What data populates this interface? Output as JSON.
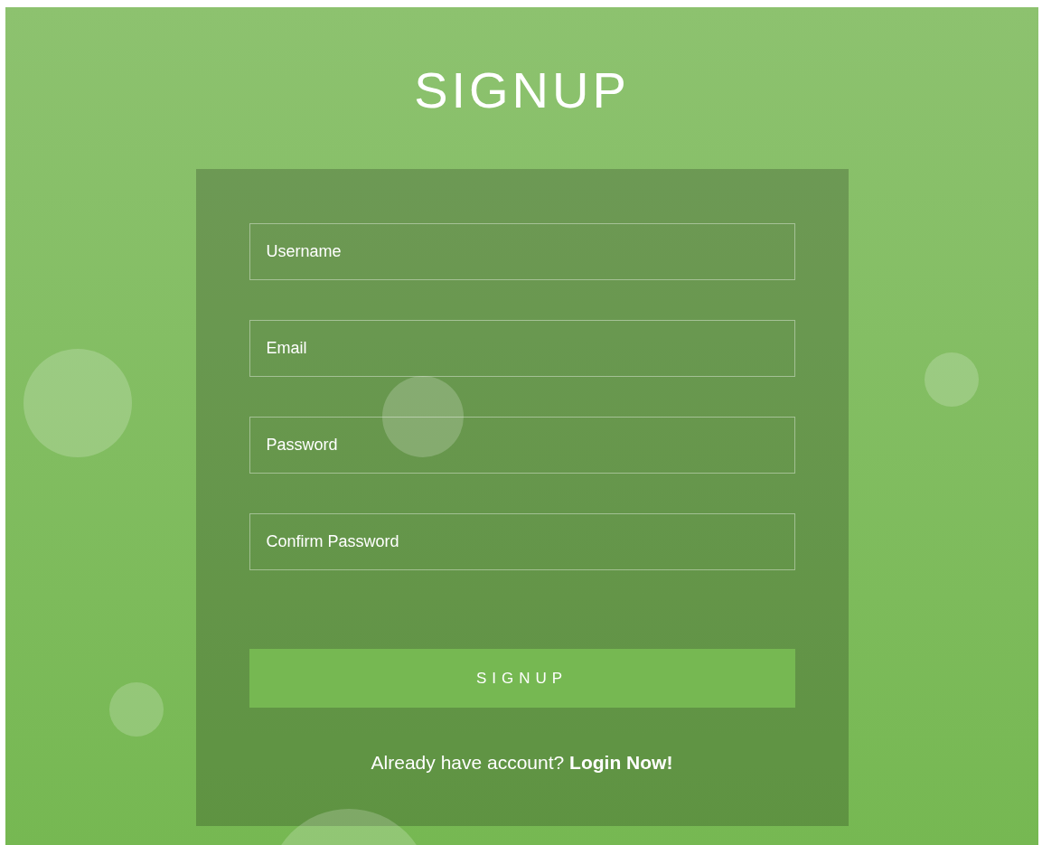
{
  "title": "SIGNUP",
  "fields": [
    {
      "placeholder": "Username"
    },
    {
      "placeholder": "Email"
    },
    {
      "placeholder": "Password"
    },
    {
      "placeholder": "Confirm Password"
    }
  ],
  "submit": {
    "label": "SIGNUP"
  },
  "footer": {
    "text": "Already have account?",
    "link": "Login Now!"
  }
}
